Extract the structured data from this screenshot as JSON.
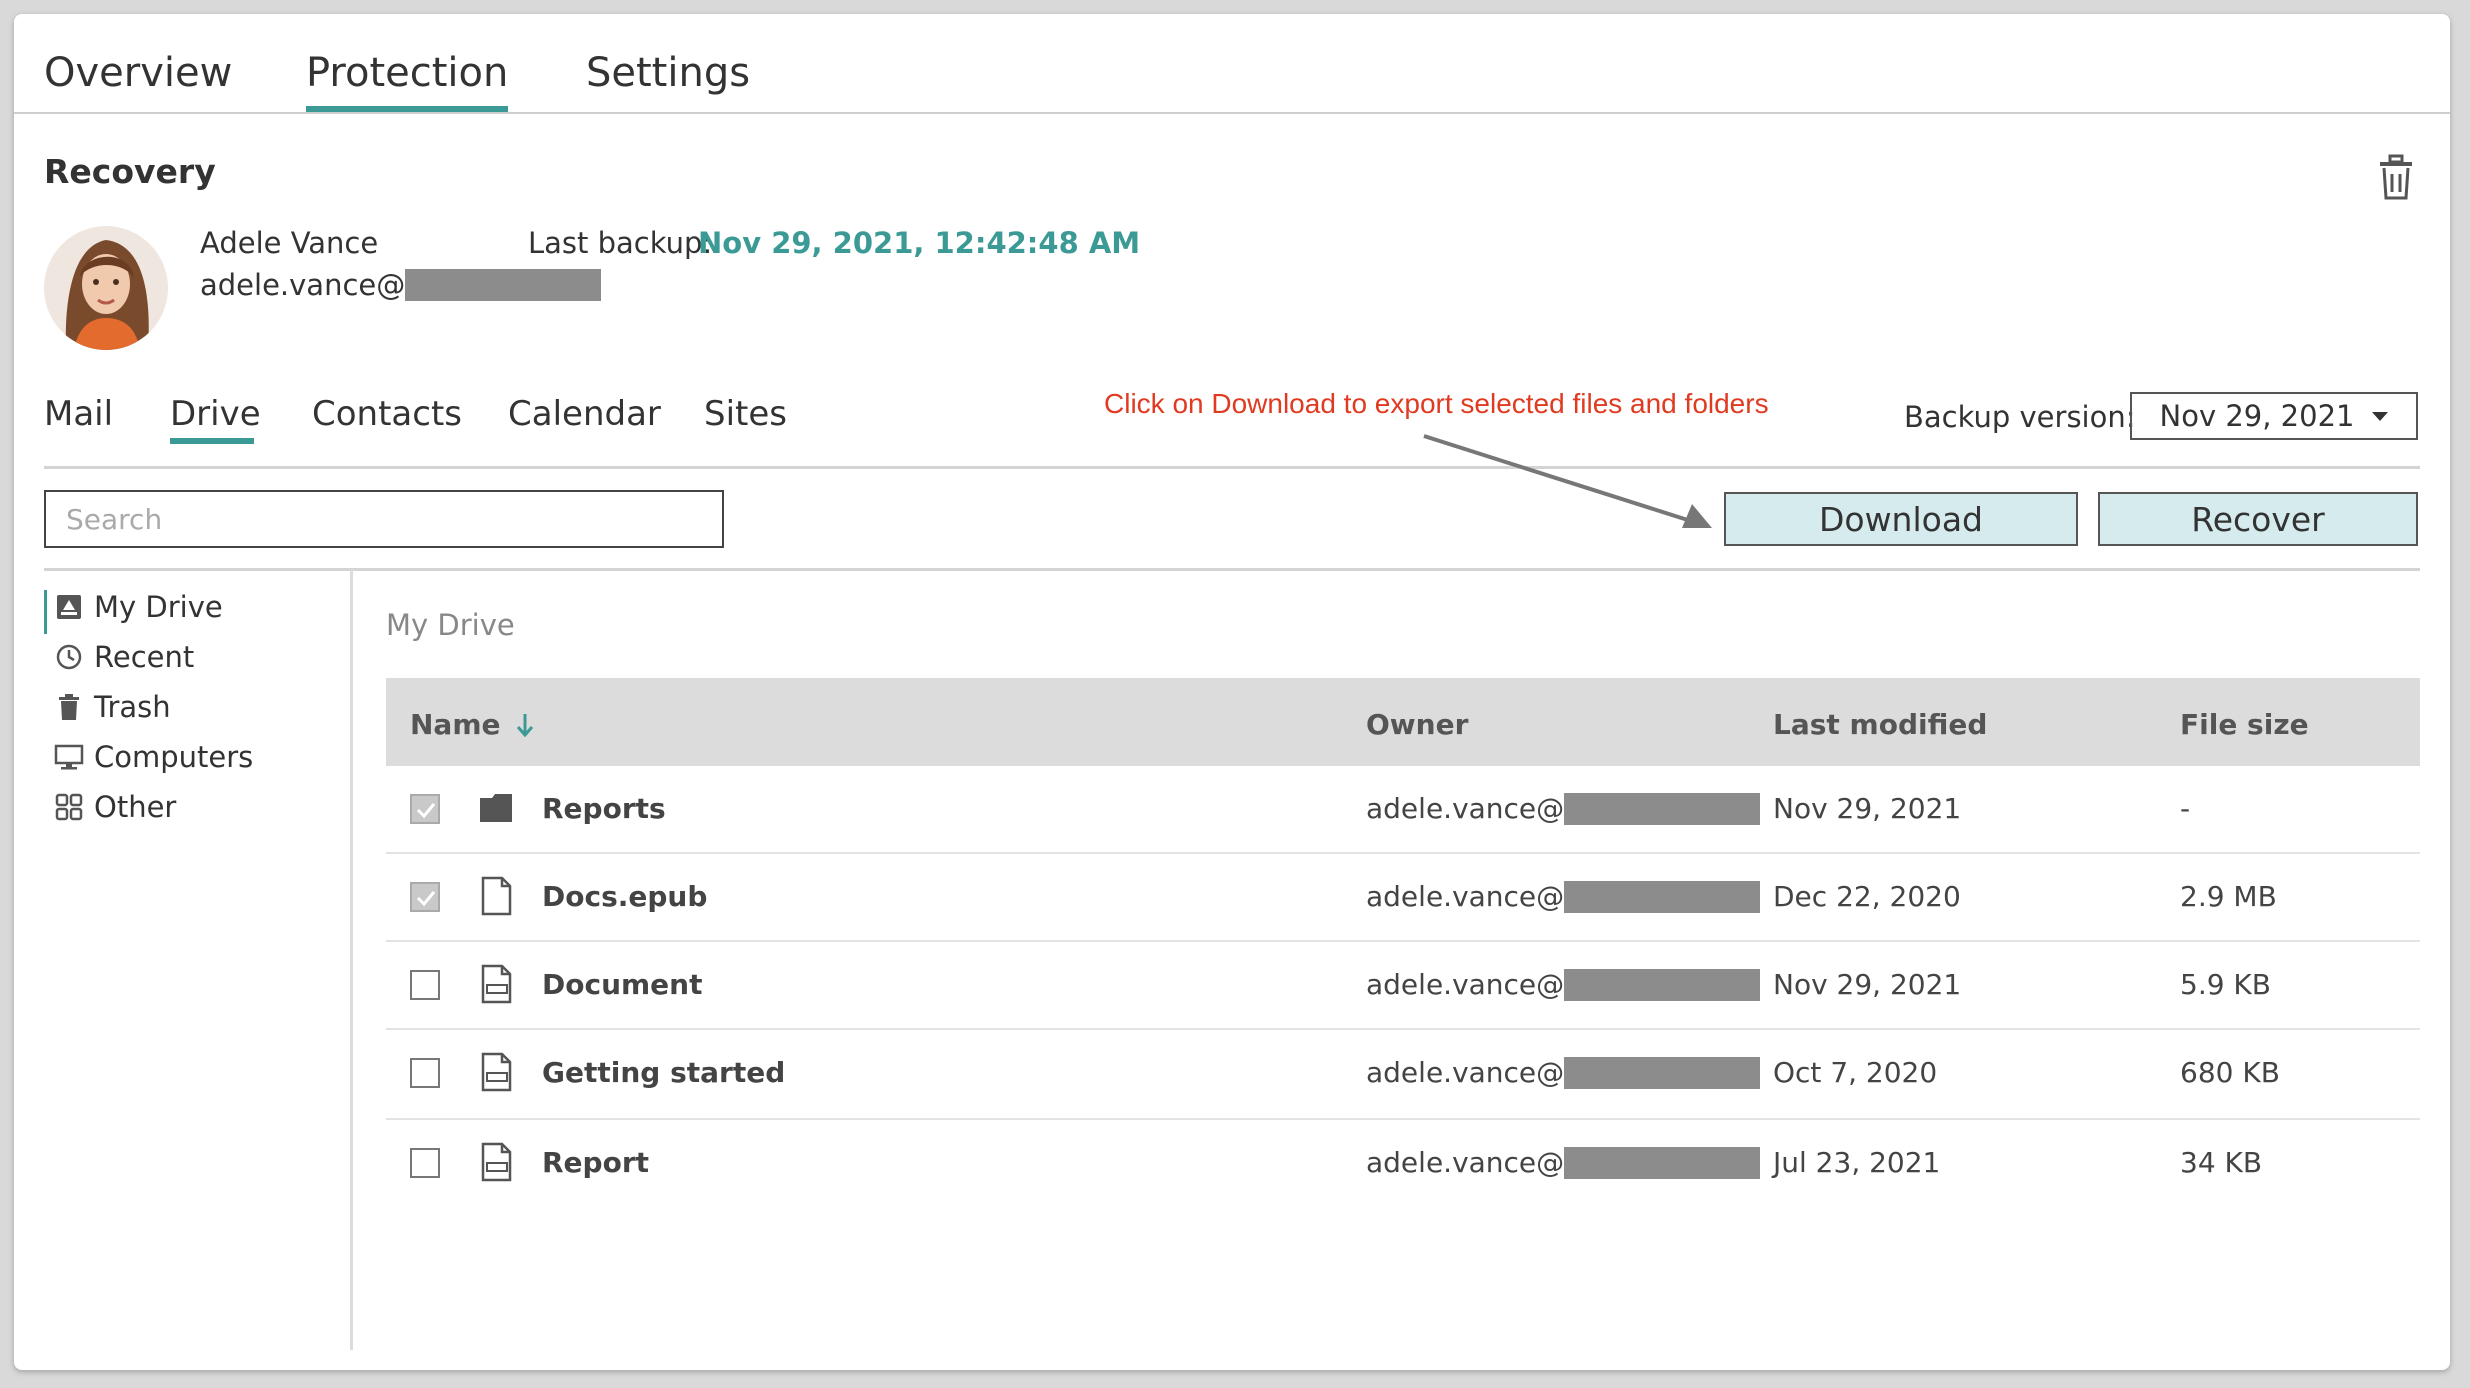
{
  "top_tabs": [
    "Overview",
    "Protection",
    "Settings"
  ],
  "active_top_tab": "Protection",
  "section_title": "Recovery",
  "user": {
    "name": "Adele Vance",
    "email_prefix": "adele.vance@"
  },
  "last_backup": {
    "label": "Last backup:",
    "value": "Nov 29, 2021, 12:42:48 AM"
  },
  "sub_tabs": [
    "Mail",
    "Drive",
    "Contacts",
    "Calendar",
    "Sites"
  ],
  "active_sub_tab": "Drive",
  "annotation": "Click on Download to export selected files and folders",
  "backup_version": {
    "label": "Backup version:",
    "value": "Nov 29, 2021"
  },
  "search": {
    "placeholder": "Search"
  },
  "buttons": {
    "download": "Download",
    "recover": "Recover"
  },
  "sidebar": [
    {
      "label": "My Drive",
      "icon": "drive-icon",
      "active": true
    },
    {
      "label": "Recent",
      "icon": "clock-icon"
    },
    {
      "label": "Trash",
      "icon": "trash-icon"
    },
    {
      "label": "Computers",
      "icon": "monitor-icon"
    },
    {
      "label": "Other",
      "icon": "grid-icon"
    }
  ],
  "breadcrumb": "My Drive",
  "table": {
    "columns": [
      "Name",
      "Owner",
      "Last modified",
      "File size"
    ],
    "sort_column": "Name",
    "rows": [
      {
        "checked": true,
        "type": "folder",
        "name": "Reports",
        "owner": "adele.vance@",
        "modified": "Nov 29, 2021",
        "size": "-"
      },
      {
        "checked": true,
        "type": "file",
        "name": "Docs.epub",
        "owner": "adele.vance@",
        "modified": "Dec 22, 2020",
        "size": "2.9 MB"
      },
      {
        "checked": false,
        "type": "doc",
        "name": "Document",
        "owner": "adele.vance@",
        "modified": "Nov 29, 2021",
        "size": "5.9 KB"
      },
      {
        "checked": false,
        "type": "pdf",
        "name": "Getting started",
        "owner": "adele.vance@",
        "modified": "Oct 7, 2020",
        "size": "680 KB"
      },
      {
        "checked": false,
        "type": "ppt",
        "name": "Report",
        "owner": "adele.vance@",
        "modified": "Jul 23, 2021",
        "size": "34 KB"
      }
    ]
  },
  "colors": {
    "accent": "#3b9a95",
    "annotation": "#e03a21",
    "button_bg": "#d6ebee"
  }
}
